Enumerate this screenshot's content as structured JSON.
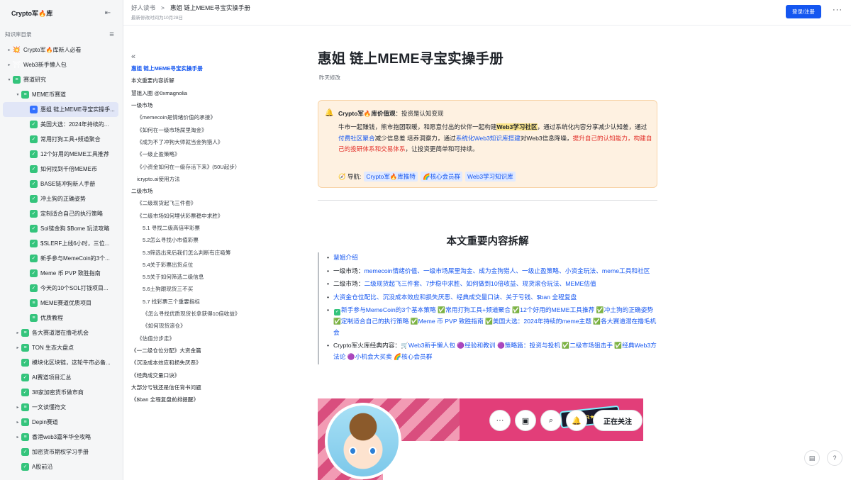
{
  "sidebar": {
    "title": "Crypto军🔥库",
    "subtitle": "知识库目录",
    "items": [
      {
        "label": "Crypto军🔥库新人必看",
        "icon": "fire-emoji-icon",
        "glyph": "💥",
        "arrow": "▸",
        "level": 1,
        "kind": "emoji"
      },
      {
        "label": "Web3新手懒人包",
        "icon": "gate-emoji-icon",
        "glyph": "⛩",
        "arrow": "▸",
        "level": 1,
        "kind": "emoji"
      },
      {
        "label": "赛道研究",
        "icon": "doc-icon",
        "glyph": "≡",
        "arrow": "▾",
        "level": 1,
        "kind": "g"
      },
      {
        "label": "MEME币赛道",
        "icon": "doc-icon",
        "glyph": "≡",
        "arrow": "▾",
        "level": 2,
        "kind": "g"
      },
      {
        "label": "惠姐 链上MEME寻宝实操手...",
        "icon": "doc-icon",
        "glyph": "≡",
        "arrow": "",
        "level": 3,
        "kind": "b",
        "active": true
      },
      {
        "label": "美国大选：2024年持续的...",
        "icon": "check-icon",
        "glyph": "✓",
        "arrow": "",
        "level": 3,
        "kind": "g"
      },
      {
        "label": "常用打狗工具+频道聚合",
        "icon": "check-icon",
        "glyph": "✓",
        "arrow": "",
        "level": 3,
        "kind": "g"
      },
      {
        "label": "12个好用的MEME工具推荐",
        "icon": "check-icon",
        "glyph": "✓",
        "arrow": "",
        "level": 3,
        "kind": "g"
      },
      {
        "label": "如何找到千倍MEME币",
        "icon": "check-icon",
        "glyph": "✓",
        "arrow": "",
        "level": 3,
        "kind": "g"
      },
      {
        "label": "BASE链冲狗新人手册",
        "icon": "check-icon",
        "glyph": "✓",
        "arrow": "",
        "level": 3,
        "kind": "g"
      },
      {
        "label": "冲土狗的正确姿势",
        "icon": "check-icon",
        "glyph": "✓",
        "arrow": "",
        "level": 3,
        "kind": "g"
      },
      {
        "label": "定制适合自己的执行策略",
        "icon": "check-icon",
        "glyph": "✓",
        "arrow": "",
        "level": 3,
        "kind": "g"
      },
      {
        "label": "Sol链金狗 $Bome 玩法攻略",
        "icon": "check-icon",
        "glyph": "✓",
        "arrow": "",
        "level": 3,
        "kind": "g"
      },
      {
        "label": "$SLERF上线6小时，三位...",
        "icon": "check-icon",
        "glyph": "✓",
        "arrow": "",
        "level": 3,
        "kind": "g"
      },
      {
        "label": "新手参与MemeCoin的3个...",
        "icon": "check-icon",
        "glyph": "✓",
        "arrow": "",
        "level": 3,
        "kind": "g"
      },
      {
        "label": "Meme 币 PVP 致胜指南",
        "icon": "check-icon",
        "glyph": "✓",
        "arrow": "",
        "level": 3,
        "kind": "g"
      },
      {
        "label": "今天的10个SOL打钱项目...",
        "icon": "check-icon",
        "glyph": "✓",
        "arrow": "",
        "level": 3,
        "kind": "g"
      },
      {
        "label": "MEME赛道优质项目",
        "icon": "doc-icon",
        "glyph": "≡",
        "arrow": "",
        "level": 3,
        "kind": "g"
      },
      {
        "label": "优质教程",
        "icon": "doc-icon",
        "glyph": "≡",
        "arrow": "",
        "level": 3,
        "kind": "g"
      },
      {
        "label": "各大赛道潜在撸毛机会",
        "icon": "doc-icon",
        "glyph": "≡",
        "arrow": "▸",
        "level": 2,
        "kind": "g"
      },
      {
        "label": "TON 生态大盘点",
        "icon": "doc-icon",
        "glyph": "≡",
        "arrow": "▸",
        "level": 2,
        "kind": "g"
      },
      {
        "label": "模块化区块链，这轮牛市必备...",
        "icon": "check-icon",
        "glyph": "✓",
        "arrow": "",
        "level": 2,
        "kind": "g"
      },
      {
        "label": "AI赛道项目汇总",
        "icon": "check-icon",
        "glyph": "✓",
        "arrow": "",
        "level": 2,
        "kind": "g"
      },
      {
        "label": "38家加密货币做市商",
        "icon": "check-icon",
        "glyph": "✓",
        "arrow": "",
        "level": 2,
        "kind": "g"
      },
      {
        "label": "一文读懂符文",
        "icon": "doc-icon",
        "glyph": "≡",
        "arrow": "▸",
        "level": 2,
        "kind": "g"
      },
      {
        "label": "Depin赛道",
        "icon": "doc-icon",
        "glyph": "≡",
        "arrow": "▸",
        "level": 2,
        "kind": "g"
      },
      {
        "label": "香港web3嘉年华全攻略",
        "icon": "doc-icon",
        "glyph": "≡",
        "arrow": "▸",
        "level": 2,
        "kind": "g"
      },
      {
        "label": "加密货币期权学习手册",
        "icon": "check-icon",
        "glyph": "✓",
        "arrow": "",
        "level": 2,
        "kind": "g"
      },
      {
        "label": "A股前沿",
        "icon": "check-icon",
        "glyph": "✓",
        "arrow": "",
        "level": 2,
        "kind": "g"
      }
    ]
  },
  "topbar": {
    "breadcrumb_root": "好人读书",
    "breadcrumb_sep": ">",
    "breadcrumb_current": "惠姐 链上MEME寻宝实操手册",
    "modified": "最新修改时间为10月28日",
    "login_label": "登录/注册",
    "more_label": "···"
  },
  "toc": {
    "collapse_glyph": "«",
    "items": [
      {
        "label": "惠姐 链上MEME寻宝实操手册",
        "level": 1,
        "active": true
      },
      {
        "label": "本文重要内容拆解",
        "level": 1
      },
      {
        "label": "慧姐入圈 @0xmagnolia",
        "level": 1
      },
      {
        "label": "一级市场",
        "level": 1
      },
      {
        "label": "《memecoin是情绪价值的承接》",
        "level": 2
      },
      {
        "label": "《如何在一级市场屎里淘金》",
        "level": 2
      },
      {
        "label": "《成为不了冲狗大师就当金狗猎人》",
        "level": 2
      },
      {
        "label": "《一级止盈策略》",
        "level": 2
      },
      {
        "label": "《小资金如何在一级存活下来》(50U起步）",
        "level": 2
      },
      {
        "label": "icrypto.ai使用方法",
        "level": 2
      },
      {
        "label": "二级市场",
        "level": 1
      },
      {
        "label": "《二级现货起飞三件套》",
        "level": 2
      },
      {
        "label": "《二级市场如何埋伏彩票稳中求胜》",
        "level": 2
      },
      {
        "label": "5.1 寻找二级高倍率彩票",
        "level": 3
      },
      {
        "label": "5.2怎么寻找小市值彩票",
        "level": 3
      },
      {
        "label": "5.3筛选出来后我们怎么判断有庄吸筹",
        "level": 3
      },
      {
        "label": "5.4关于彩票出货点位",
        "level": 3
      },
      {
        "label": "5.5关于如何筛选二级信息",
        "level": 3
      },
      {
        "label": "5.6土狗跟现货三不买",
        "level": 3
      },
      {
        "label": "5.7 找彩票三个重要指标",
        "level": 3
      },
      {
        "label": "《怎么寻找优质现货长拿获得10倍收益》",
        "level": 3
      },
      {
        "label": "《如何现货滚仓》",
        "level": 3
      },
      {
        "label": "《估值分步走》",
        "level": 2
      },
      {
        "label": "《一二级仓位分配》大资金篇",
        "level": 1
      },
      {
        "label": "《沉没成本效应和损失厌恶》",
        "level": 1
      },
      {
        "label": "《经典成交量口诀》",
        "level": 1
      },
      {
        "label": "大部分亏钱还是信任背书问题",
        "level": 1
      },
      {
        "label": "《$ban 全程复盘前排提醒》",
        "level": 1
      }
    ]
  },
  "doc": {
    "title": "惠姐 链上MEME寻宝实操手册",
    "meta": "昨天修改",
    "callout": {
      "head_bold": "Crypto军🔥库价值观",
      "head_rest": "：投资是认知变现",
      "body_1": "牛市一起赚钱，熊市抱团取暖，和愿意付出的伙伴一起构建",
      "body_hl": "Web3学习社区",
      "body_2": "，通过系统化内容分享减少认知差，通过",
      "body_link1": "付费社区聚合",
      "body_3": "减少信息差 培养洞察力，通过",
      "body_link2": "系统化Web3知识库搭建",
      "body_4": "对Web3信息降噪，",
      "body_red": "提升自己的认知能力，构建自己的投研体系和交易体系",
      "body_5": "，让投资更简单和可持续。",
      "nav_label": "🧭 导航:",
      "nav_1": "Crypto军🔥库推特",
      "nav_2": "🌈核心会员群",
      "nav_3": "Web3学习知识库"
    },
    "section_title": "本文重要内容拆解",
    "quote": {
      "l1": "慧姐介绍",
      "l2_prefix": "一级市场：",
      "l2": "memecoin情绪价值、一级市场屎里淘金、成为金狗猎人、一级止盈策略、小资金玩法、meme工具和社区",
      "l3_prefix": "二级市场：",
      "l3": "二级现货起飞三件套、7步稳中求胜、如何做到10倍收益、现货滚仓玩法、MEME估值",
      "l4": "大资金仓位配比、沉没成本效应和损失厌恶、经典成交量口诀、关于亏钱、$ban 全程复盘",
      "l5": "新手参与MemeCoin的3个基本策略 ✅常用打狗工具+频道聚合 ✅12个好用的MEME工具推荐 ✅冲土狗的正确姿势 ✅定制适合自己的执行策略 ✅Meme 币 PVP 致胜指南 ✅美国大选：2024年持续的meme主题 ✅各大赛道潜在撸毛机会",
      "l6_prefix": "Crypto军火库经典内容：",
      "l6": "🛒Web3新手懒人包 🟣经验和教训 🟣策略篇：投资与投机 ✅二级市场狙击手 ✅经典Web3方法论 🟣小机会大买卖 🌈核心会员群"
    },
    "banner_sign": "SUPER★CHAT",
    "follow_label": "正在关注"
  },
  "icons": {
    "accent": "#1456f0",
    "green": "#34c47c"
  }
}
